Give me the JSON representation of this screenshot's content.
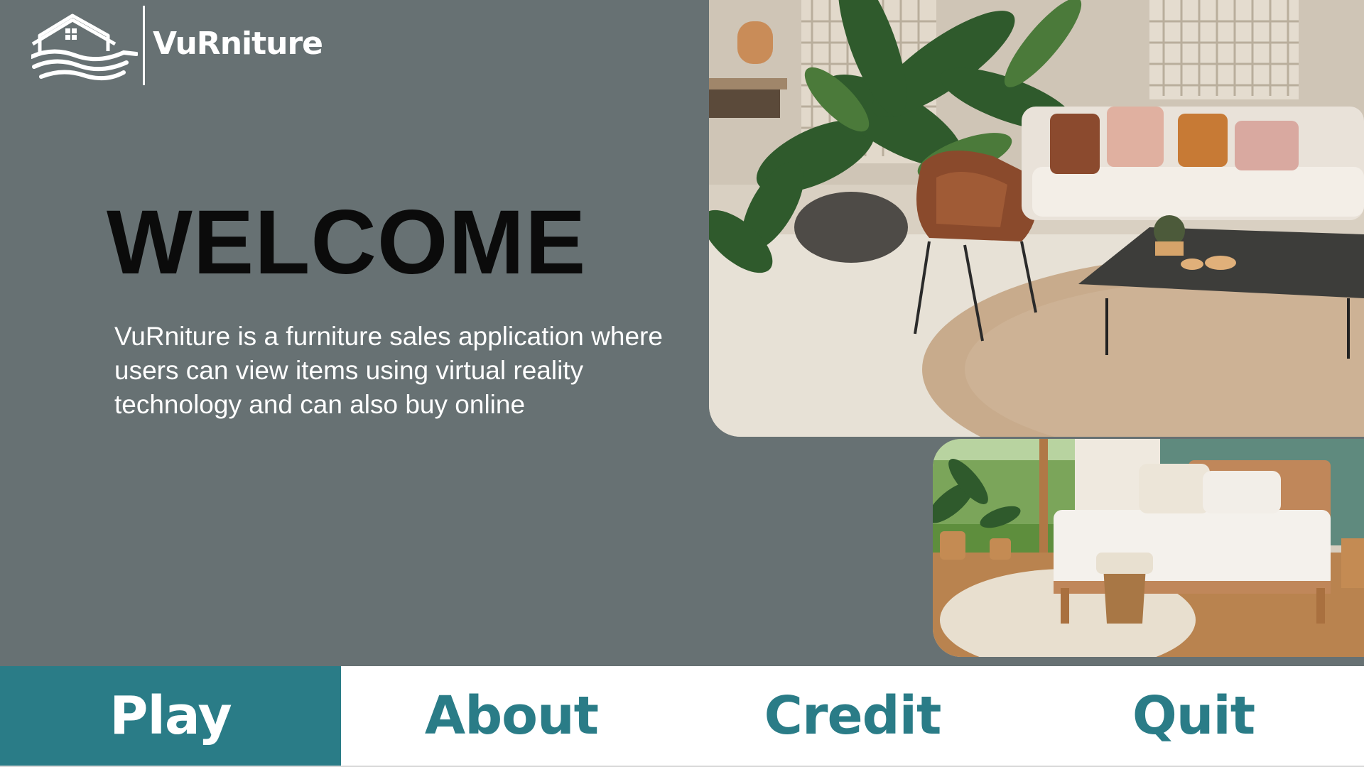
{
  "app": {
    "brand_name": "VuRniture",
    "logo_icon": "house-waves-icon"
  },
  "welcome": {
    "title": "WELCOME",
    "description": "VuRniture is a furniture sales application where users can view items using virtual reality technology and can also buy online"
  },
  "images": {
    "living_room": "living-room-photo",
    "bedroom": "bedroom-photo"
  },
  "menu": {
    "items": [
      {
        "label": "Play",
        "active": true
      },
      {
        "label": "About",
        "active": false
      },
      {
        "label": "Credit",
        "active": false
      },
      {
        "label": "Quit",
        "active": false
      }
    ]
  },
  "colors": {
    "panel": "#677173",
    "accent": "#2a7c87",
    "title": "#0b0b0b",
    "text": "#ffffff"
  }
}
